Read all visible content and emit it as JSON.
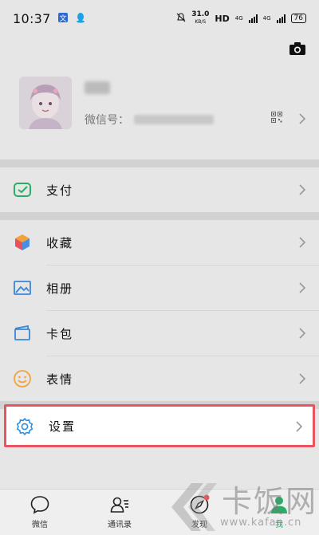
{
  "status_bar": {
    "time": "10:37",
    "net_speed_value": "31.0",
    "net_speed_unit": "KB/S",
    "hd_label": "HD",
    "signal_1": "4G",
    "signal_2": "4G",
    "battery": "76"
  },
  "profile": {
    "wechat_id_label": "微信号："
  },
  "menu": {
    "pay": "支付",
    "favorites": "收藏",
    "album": "相册",
    "cards": "卡包",
    "stickers": "表情",
    "settings": "设置"
  },
  "tabs": [
    {
      "label": "微信"
    },
    {
      "label": "通讯录"
    },
    {
      "label": "发现"
    },
    {
      "label": "我"
    }
  ],
  "watermark": {
    "brand": "卡饭网",
    "url": "www.kafan.cn"
  },
  "colors": {
    "highlight_border": "#e8555e",
    "pay_green": "#2aae67",
    "settings_blue": "#2e8fe0",
    "background_dim": "#e6e6e6"
  }
}
